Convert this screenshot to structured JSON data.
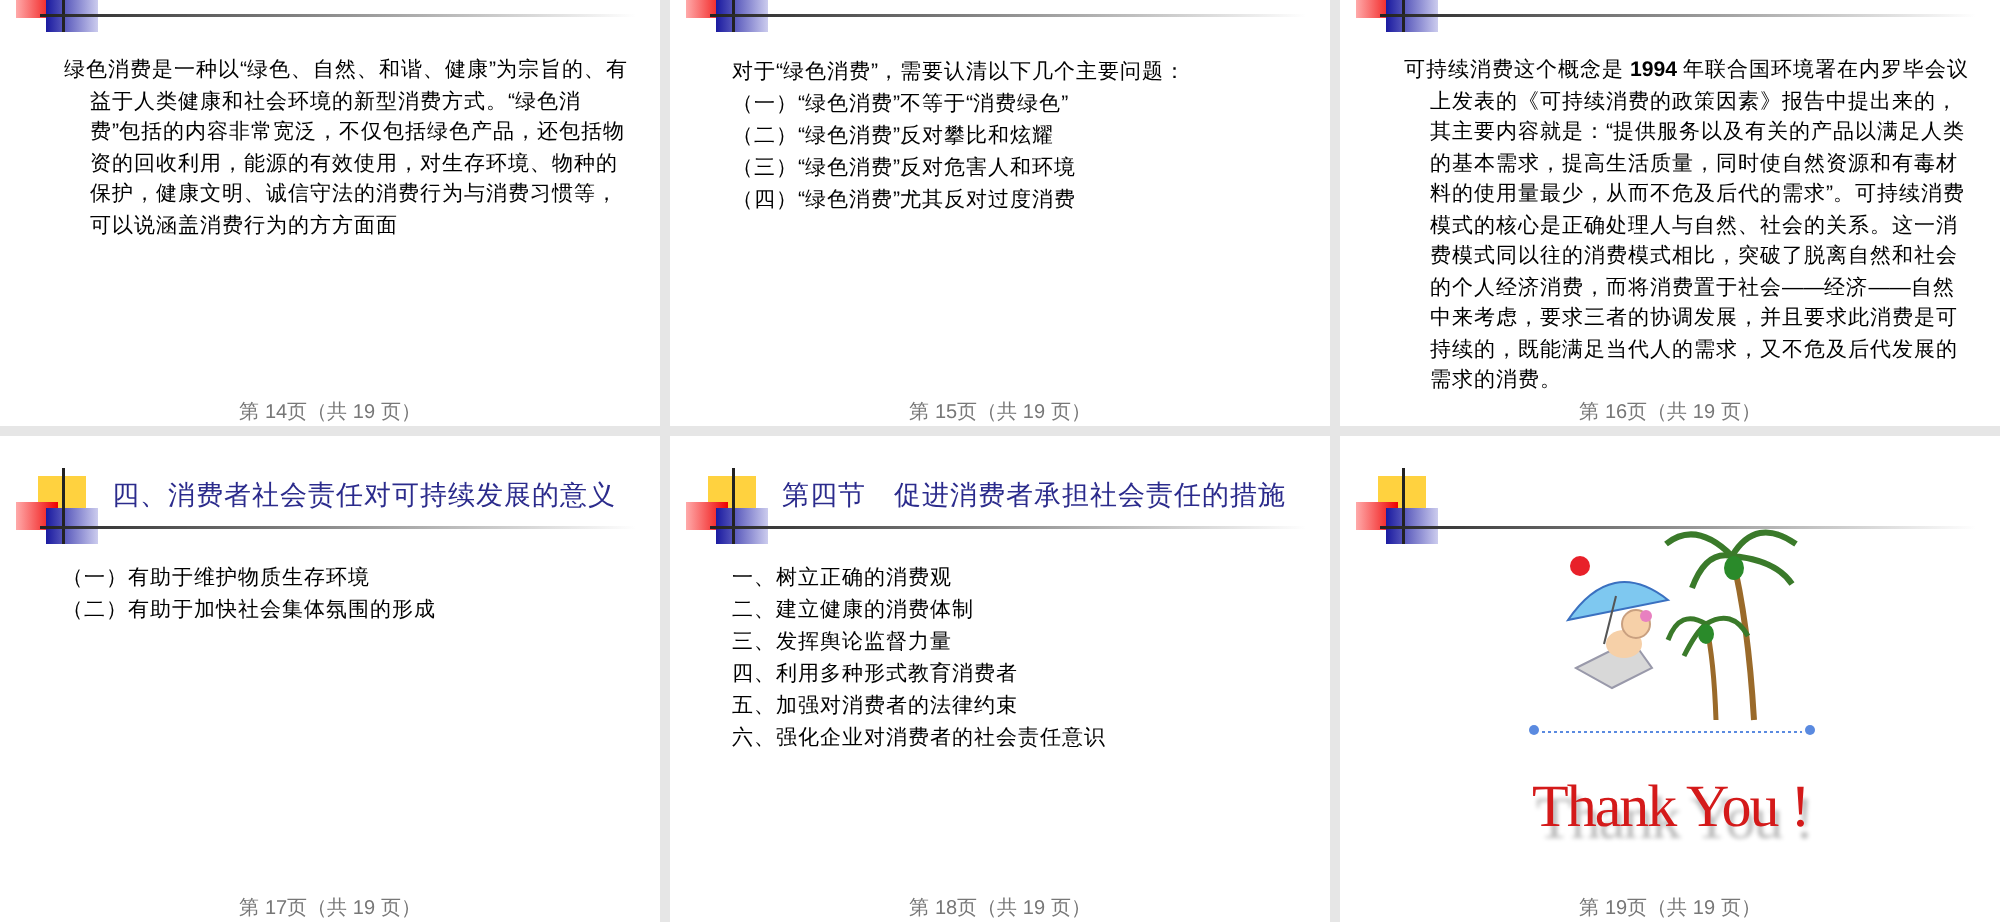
{
  "slides": [
    {
      "kind": "paragraph",
      "text": "绿色消费是一种以“绿色、自然、和谐、健康”为宗旨的、有益于人类健康和社会环境的新型消费方式。“绿色消费”包括的内容非常宽泛，不仅包括绿色产品，还包括物资的回收利用，能源的有效使用，对生存环境、物种的保护，健康文明、诚信守法的消费行为与消费习惯等，可以说涵盖消费行为的方方面面",
      "footer": "第 14页（共 19 页）"
    },
    {
      "kind": "list",
      "lines": [
        "对于“绿色消费”，需要认清以下几个主要问题：",
        "（一）“绿色消费”不等于“消费绿色”",
        "（二）“绿色消费”反对攀比和炫耀",
        "（三）“绿色消费”反对危害人和环境",
        "（四）“绿色消费”尤其反对过度消费"
      ],
      "footer": "第 15页（共 19 页）"
    },
    {
      "kind": "paragraph",
      "text": "可持续消费这个概念是 **1994** 年联合国环境署在内罗毕会议上发表的《可持续消费的政策因素》报告中提出来的，其主要内容就是：“提供服务以及有关的产品以满足人类的基本需求，提高生活质量，同时使自然资源和有毒材料的使用量最少，从而不危及后代的需求”。可持续消费模式的核心是正确处理人与自然、社会的关系。这一消费模式同以往的消费模式相比，突破了脱离自然和社会的个人经济消费，而将消费置于社会——经济——自然中来考虑，要求三者的协调发展，并且要求此消费是可持续的，既能满足当代人的需求，又不危及后代发展的需求的消费。",
      "footer": "第 16页（共 19 页）"
    },
    {
      "kind": "titled_list",
      "title": "四、消费者社会责任对可持续发展的意义",
      "lines": [
        "（一）有助于维护物质生存环境",
        "（二）有助于加快社会集体氛围的形成"
      ],
      "footer": "第 17页（共 19 页）"
    },
    {
      "kind": "titled_list",
      "title": "第四节　促进消费者承担社会责任的措施",
      "lines": [
        "一、树立正确的消费观",
        "二、建立健康的消费体制",
        "三、发挥舆论监督力量",
        "四、利用多种形式教育消费者",
        "五、加强对消费者的法律约束",
        "六、强化企业对消费者的社会责任意识"
      ],
      "footer": "第 18页（共 19 页）"
    },
    {
      "kind": "closing",
      "message": "Thank You !",
      "footer": "第 19页（共 19 页）"
    }
  ]
}
